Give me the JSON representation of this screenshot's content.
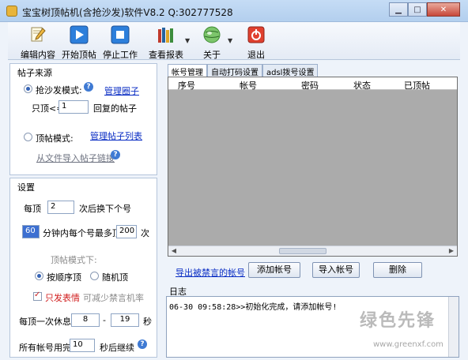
{
  "window": {
    "title": "宝宝树顶帖机(含抢沙发)软件V8.2 Q:302777528"
  },
  "toolbar": [
    {
      "label": "编辑内容",
      "icon": "pencil-icon"
    },
    {
      "label": "开始顶帖",
      "icon": "play-icon"
    },
    {
      "label": "停止工作",
      "icon": "stop-icon"
    },
    {
      "label": "查看报表",
      "icon": "books-icon"
    },
    {
      "label": "关于",
      "icon": "globe-icon"
    },
    {
      "label": "退出",
      "icon": "power-icon"
    }
  ],
  "left": {
    "source_title": "帖子来源",
    "sofa_mode": "抢沙发模式:",
    "manage_circle": "管理圈子",
    "only_top_prefix": "只顶<=",
    "only_top_value": "1",
    "only_top_suffix": "回复的帖子",
    "top_mode": "顶帖模式:",
    "manage_list": "管理帖子列表",
    "import_links": "从文件导入帖子链接",
    "settings_title": "设置",
    "per_top": "每顶",
    "per_top_value": "2",
    "per_top_suffix": "次后换下个号",
    "minutes_value": "60",
    "minutes_mid": "分钟内每个号最多顶",
    "max_value": "200",
    "max_suffix": "次",
    "top_mode_sub": "顶帖模式下:",
    "order_top": "按顺序顶",
    "random_top": "随机顶",
    "only_emoji": "只发表情",
    "reduce_ban": "可减少禁言机率",
    "rest_label": "每顶一次休息",
    "rest_from": "8",
    "rest_dash": "-",
    "rest_to": "19",
    "rest_unit": "秒",
    "all_used": "所有帐号用完",
    "all_used_value": "10",
    "continue_after": "秒后继续"
  },
  "tabs": [
    "帐号管理",
    "自动打码设置",
    "adsl拨号设置"
  ],
  "grid": {
    "columns": [
      "序号",
      "帐号",
      "密码",
      "状态",
      "已顶帖"
    ]
  },
  "actions": {
    "export_banned": "导出被禁言的帐号",
    "add_account": "添加帐号",
    "import_account": "导入帐号",
    "delete": "删除"
  },
  "log": {
    "title": "日志",
    "lines": [
      "06-30 09:58:28>>初始化完成，请添加帐号!"
    ]
  },
  "watermark": {
    "text": "绿色先锋",
    "url": "www.greenxf.com"
  }
}
